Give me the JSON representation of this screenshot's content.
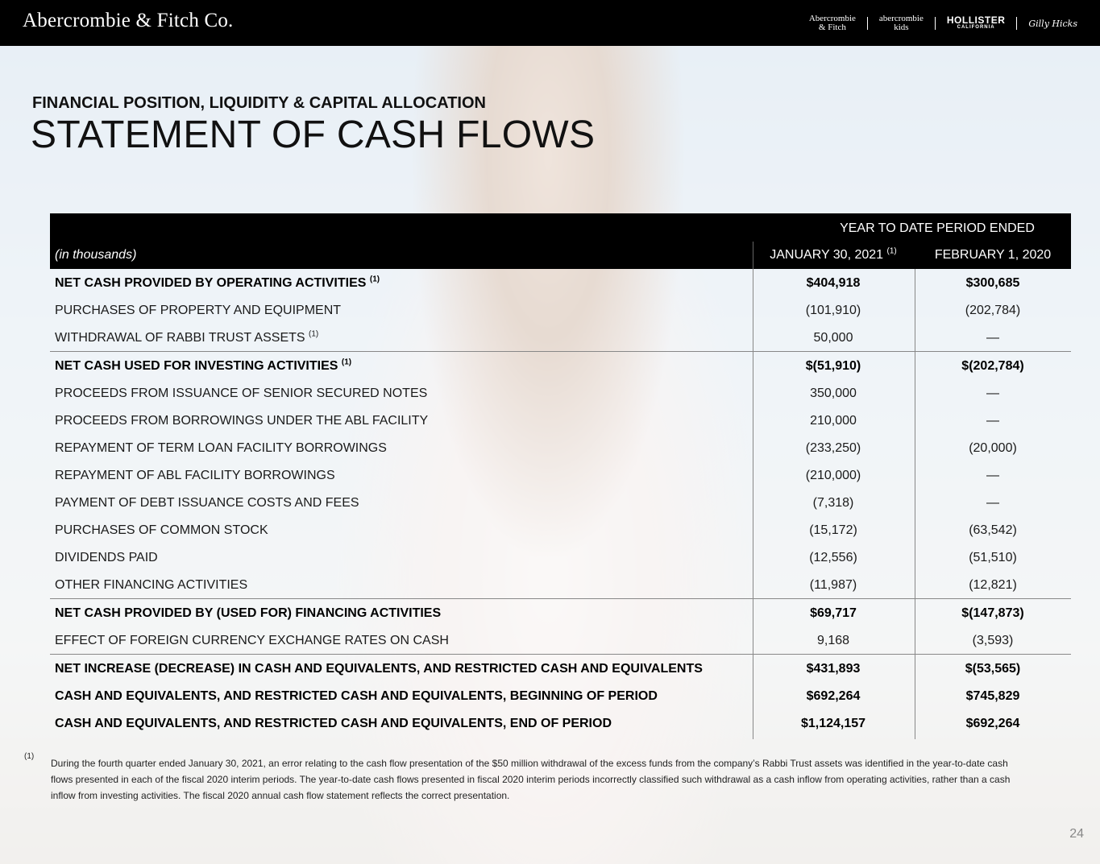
{
  "header": {
    "company": "Abercrombie & Fitch Co.",
    "brands": [
      {
        "line1": "Abercrombie",
        "line2": "& Fitch"
      },
      {
        "line1": "abercrombie",
        "line2": "kids"
      },
      {
        "line1": "HOLLISTER",
        "line2": "CALIFORNIA"
      },
      {
        "line1": "Gilly Hicks",
        "line2": ""
      }
    ]
  },
  "page": {
    "eyebrow": "FINANCIAL POSITION, LIQUIDITY & CAPITAL ALLOCATION",
    "title": "STATEMENT OF CASH FLOWS",
    "page_number": "24"
  },
  "table": {
    "period_header": "YEAR TO DATE PERIOD ENDED",
    "units": "(in thousands)",
    "col1": "JANUARY 30, 2021",
    "col1_note": "(1)",
    "col2": "FEBRUARY 1, 2020",
    "rows": [
      {
        "label": "NET CASH PROVIDED BY OPERATING ACTIVITIES",
        "note": "(1)",
        "v1": "$404,918",
        "v2": "$300,685",
        "bold": true,
        "topline": false
      },
      {
        "label": "PURCHASES OF PROPERTY AND EQUIPMENT",
        "note": "",
        "v1": "(101,910)",
        "v2": "(202,784)",
        "bold": false,
        "topline": false
      },
      {
        "label": "WITHDRAWAL OF RABBI TRUST ASSETS",
        "note": "(1)",
        "v1": "50,000",
        "v2": "—",
        "bold": false,
        "topline": false
      },
      {
        "label": "NET CASH USED FOR INVESTING ACTIVITIES",
        "note": "(1)",
        "v1": "$(51,910)",
        "v2": "$(202,784)",
        "bold": true,
        "topline": true
      },
      {
        "label": "PROCEEDS FROM ISSUANCE OF SENIOR SECURED NOTES",
        "note": "",
        "v1": "350,000",
        "v2": "—",
        "bold": false,
        "topline": false
      },
      {
        "label": "PROCEEDS FROM BORROWINGS UNDER THE ABL FACILITY",
        "note": "",
        "v1": "210,000",
        "v2": "—",
        "bold": false,
        "topline": false
      },
      {
        "label": "REPAYMENT OF TERM LOAN FACILITY BORROWINGS",
        "note": "",
        "v1": "(233,250)",
        "v2": "(20,000)",
        "bold": false,
        "topline": false
      },
      {
        "label": "REPAYMENT OF ABL FACILITY BORROWINGS",
        "note": "",
        "v1": "(210,000)",
        "v2": "—",
        "bold": false,
        "topline": false
      },
      {
        "label": "PAYMENT OF DEBT ISSUANCE COSTS AND FEES",
        "note": "",
        "v1": "(7,318)",
        "v2": "—",
        "bold": false,
        "topline": false
      },
      {
        "label": "PURCHASES OF COMMON STOCK",
        "note": "",
        "v1": "(15,172)",
        "v2": "(63,542)",
        "bold": false,
        "topline": false
      },
      {
        "label": "DIVIDENDS PAID",
        "note": "",
        "v1": "(12,556)",
        "v2": "(51,510)",
        "bold": false,
        "topline": false
      },
      {
        "label": "OTHER FINANCING ACTIVITIES",
        "note": "",
        "v1": "(11,987)",
        "v2": "(12,821)",
        "bold": false,
        "topline": false
      },
      {
        "label": "NET CASH PROVIDED BY (USED FOR) FINANCING ACTIVITIES",
        "note": "",
        "v1": "$69,717",
        "v2": "$(147,873)",
        "bold": true,
        "topline": true
      },
      {
        "label": "EFFECT OF FOREIGN CURRENCY EXCHANGE RATES ON CASH",
        "note": "",
        "v1": "9,168",
        "v2": "(3,593)",
        "bold": false,
        "topline": false
      },
      {
        "label": "NET INCREASE (DECREASE) IN CASH AND EQUIVALENTS, AND RESTRICTED CASH AND EQUIVALENTS",
        "note": "",
        "v1": "$431,893",
        "v2": "$(53,565)",
        "bold": true,
        "topline": true
      },
      {
        "label": "CASH AND EQUIVALENTS, AND RESTRICTED CASH AND EQUIVALENTS, BEGINNING OF PERIOD",
        "note": "",
        "v1": "$692,264",
        "v2": "$745,829",
        "bold": true,
        "topline": false
      },
      {
        "label": "CASH AND EQUIVALENTS, AND RESTRICTED CASH AND EQUIVALENTS, END OF PERIOD",
        "note": "",
        "v1": "$1,124,157",
        "v2": "$692,264",
        "bold": true,
        "topline": false
      }
    ]
  },
  "footnote": {
    "mark": "(1)",
    "text": "During the fourth quarter ended January 30, 2021, an error relating to the cash flow presentation of the $50 million withdrawal of the excess funds from the company’s Rabbi Trust assets was identified in the year-to-date cash flows presented in each of the fiscal 2020 interim periods. The year-to-date cash flows presented in fiscal 2020 interim periods incorrectly classified such withdrawal as a cash inflow from operating activities, rather than a cash inflow from investing activities. The fiscal 2020 annual cash flow statement reflects the correct presentation."
  }
}
